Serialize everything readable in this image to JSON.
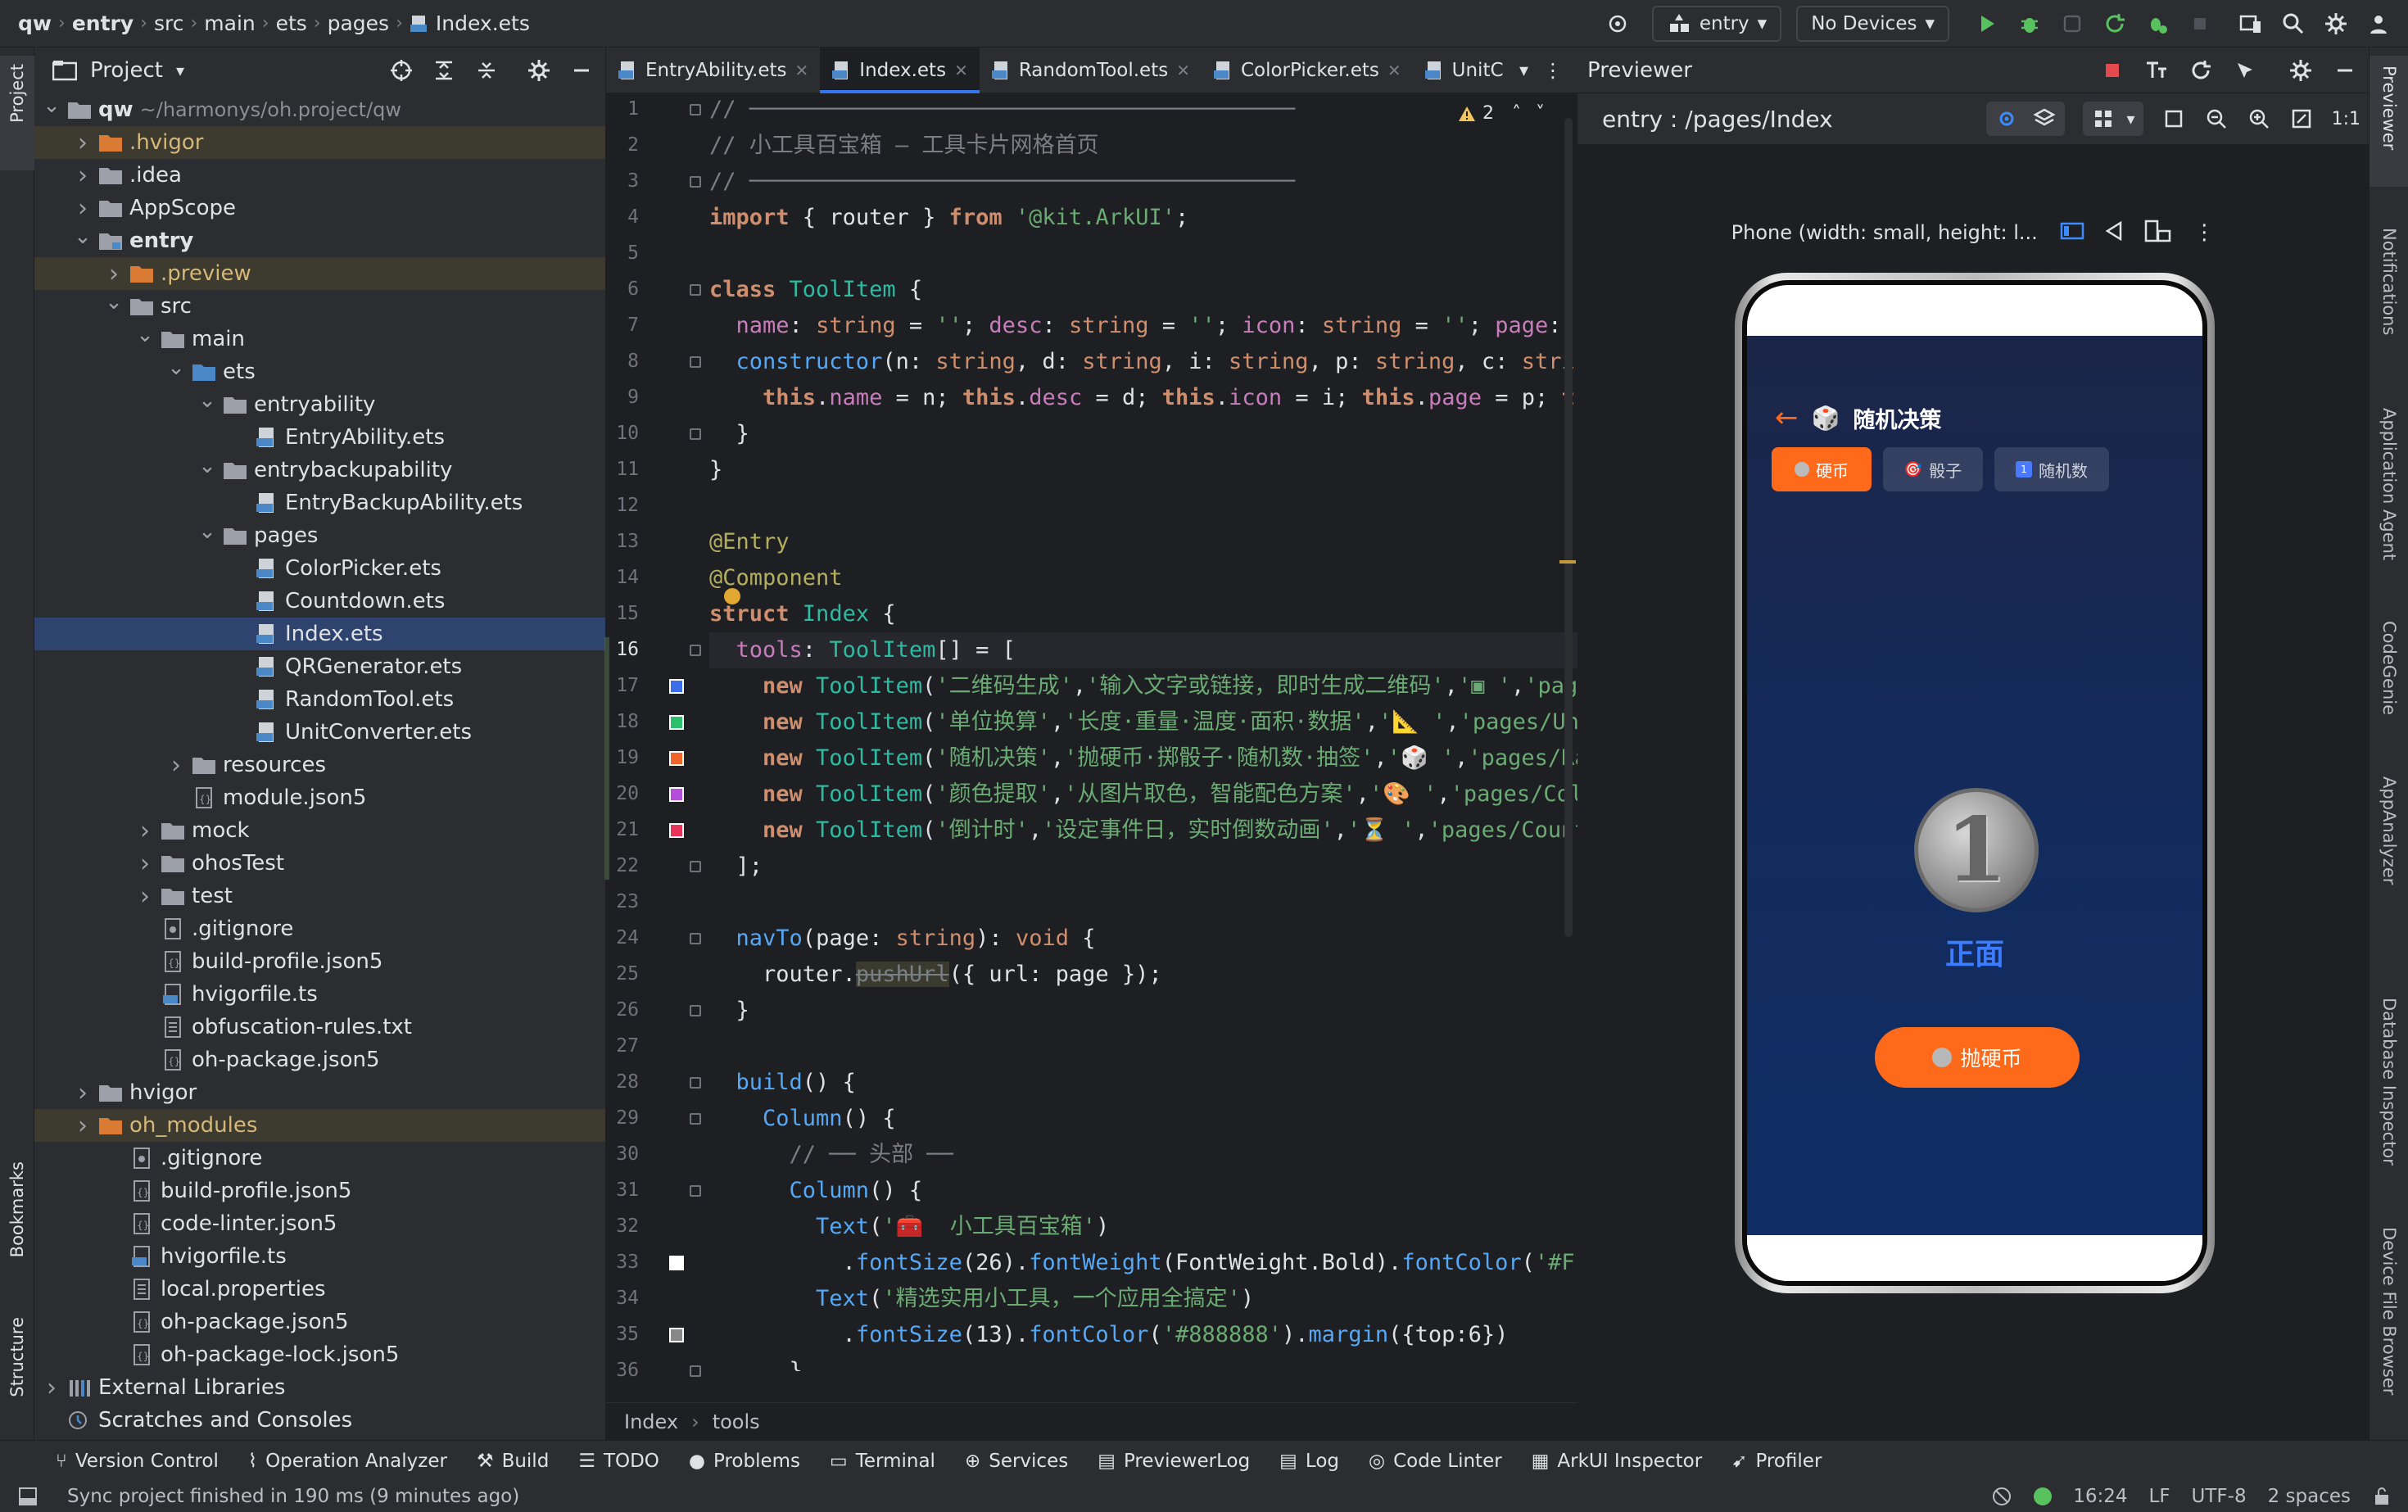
{
  "breadcrumbs": [
    "qw",
    "entry",
    "src",
    "main",
    "ets",
    "pages",
    "Index.ets"
  ],
  "toolbar": {
    "run_config": "entry",
    "device": "No Devices"
  },
  "left_strip": {
    "project": "Project",
    "bookmarks": "Bookmarks",
    "structure": "Structure"
  },
  "right_strip": {
    "previewer": "Previewer",
    "notifications": "Notifications",
    "app_agent": "Application Agent",
    "codegenie": "CodeGenie",
    "appanalyzer": "AppAnalyzer",
    "db_inspector": "Database Inspector",
    "device_file": "Device File Browser"
  },
  "project_panel": {
    "title": "Project",
    "tree": [
      {
        "label": "qw",
        "dim": "~/harmonys/oh.project/qw",
        "depth": 0,
        "chev": "v",
        "type": "folder",
        "bold": true
      },
      {
        "label": ".hvigor",
        "depth": 1,
        "chev": ">",
        "type": "folder-orange",
        "excluded": true
      },
      {
        "label": ".idea",
        "depth": 1,
        "chev": ">",
        "type": "folder"
      },
      {
        "label": "AppScope",
        "depth": 1,
        "chev": ">",
        "type": "folder"
      },
      {
        "label": "entry",
        "depth": 1,
        "chev": "v",
        "type": "folder-module",
        "bold": true
      },
      {
        "label": ".preview",
        "depth": 2,
        "chev": ">",
        "type": "folder-orange",
        "excluded": true
      },
      {
        "label": "src",
        "depth": 2,
        "chev": "v",
        "type": "folder"
      },
      {
        "label": "main",
        "depth": 3,
        "chev": "v",
        "type": "folder"
      },
      {
        "label": "ets",
        "depth": 4,
        "chev": "v",
        "type": "folder-blue"
      },
      {
        "label": "entryability",
        "depth": 5,
        "chev": "v",
        "type": "folder"
      },
      {
        "label": "EntryAbility.ets",
        "depth": 6,
        "chev": "",
        "type": "ets"
      },
      {
        "label": "entrybackupability",
        "depth": 5,
        "chev": "v",
        "type": "folder"
      },
      {
        "label": "EntryBackupAbility.ets",
        "depth": 6,
        "chev": "",
        "type": "ets"
      },
      {
        "label": "pages",
        "depth": 5,
        "chev": "v",
        "type": "folder"
      },
      {
        "label": "ColorPicker.ets",
        "depth": 6,
        "chev": "",
        "type": "ets"
      },
      {
        "label": "Countdown.ets",
        "depth": 6,
        "chev": "",
        "type": "ets"
      },
      {
        "label": "Index.ets",
        "depth": 6,
        "chev": "",
        "type": "ets",
        "selected": true
      },
      {
        "label": "QRGenerator.ets",
        "depth": 6,
        "chev": "",
        "type": "ets"
      },
      {
        "label": "RandomTool.ets",
        "depth": 6,
        "chev": "",
        "type": "ets"
      },
      {
        "label": "UnitConverter.ets",
        "depth": 6,
        "chev": "",
        "type": "ets"
      },
      {
        "label": "resources",
        "depth": 4,
        "chev": ">",
        "type": "folder"
      },
      {
        "label": "module.json5",
        "depth": 4,
        "chev": "",
        "type": "json"
      },
      {
        "label": "mock",
        "depth": 3,
        "chev": ">",
        "type": "folder"
      },
      {
        "label": "ohosTest",
        "depth": 3,
        "chev": ">",
        "type": "folder"
      },
      {
        "label": "test",
        "depth": 3,
        "chev": ">",
        "type": "folder"
      },
      {
        "label": ".gitignore",
        "depth": 3,
        "chev": "",
        "type": "file"
      },
      {
        "label": "build-profile.json5",
        "depth": 3,
        "chev": "",
        "type": "json"
      },
      {
        "label": "hvigorfile.ts",
        "depth": 3,
        "chev": "",
        "type": "ts"
      },
      {
        "label": "obfuscation-rules.txt",
        "depth": 3,
        "chev": "",
        "type": "txt"
      },
      {
        "label": "oh-package.json5",
        "depth": 3,
        "chev": "",
        "type": "json"
      },
      {
        "label": "hvigor",
        "depth": 1,
        "chev": ">",
        "type": "folder"
      },
      {
        "label": "oh_modules",
        "depth": 1,
        "chev": ">",
        "type": "folder-orange",
        "excluded": true
      },
      {
        "label": ".gitignore",
        "depth": 2,
        "chev": "",
        "type": "file"
      },
      {
        "label": "build-profile.json5",
        "depth": 2,
        "chev": "",
        "type": "json"
      },
      {
        "label": "code-linter.json5",
        "depth": 2,
        "chev": "",
        "type": "json"
      },
      {
        "label": "hvigorfile.ts",
        "depth": 2,
        "chev": "",
        "type": "ts"
      },
      {
        "label": "local.properties",
        "depth": 2,
        "chev": "",
        "type": "txt"
      },
      {
        "label": "oh-package.json5",
        "depth": 2,
        "chev": "",
        "type": "json"
      },
      {
        "label": "oh-package-lock.json5",
        "depth": 2,
        "chev": "",
        "type": "json"
      },
      {
        "label": "External Libraries",
        "depth": 0,
        "chev": ">",
        "type": "lib"
      },
      {
        "label": "Scratches and Consoles",
        "depth": 0,
        "chev": "",
        "type": "scratch"
      }
    ]
  },
  "editor": {
    "tabs": [
      {
        "label": "EntryAbility.ets",
        "active": false
      },
      {
        "label": "Index.ets",
        "active": true
      },
      {
        "label": "RandomTool.ets",
        "active": false
      },
      {
        "label": "ColorPicker.ets",
        "active": false
      },
      {
        "label": "UnitC",
        "active": false
      }
    ],
    "warnings": "2",
    "current_line": 16,
    "breadcrumb": [
      "Index",
      "tools"
    ],
    "swatches": [
      {
        "line": 17,
        "color": "#3b6ee8"
      },
      {
        "line": 18,
        "color": "#2dbf6a"
      },
      {
        "line": 19,
        "color": "#f0652a"
      },
      {
        "line": 20,
        "color": "#b44fd9"
      },
      {
        "line": 21,
        "color": "#e8335a"
      },
      {
        "line": 33,
        "color": "#ffffff"
      },
      {
        "line": 35,
        "color": "#888888"
      }
    ],
    "lines": [
      [
        [
          "cm",
          "//"
        ],
        [
          "cm",
          " ─────────────────────────────────────────"
        ]
      ],
      [
        [
          "cm",
          "// 小工具百宝箱 — 工具卡片网格首页"
        ]
      ],
      [
        [
          "cm",
          "// ─────────────────────────────────────────"
        ]
      ],
      [
        [
          "kw",
          "import"
        ],
        [
          "w",
          " { router } "
        ],
        [
          "kw",
          "from"
        ],
        [
          "str",
          " '@kit.ArkUI'"
        ],
        [
          "w",
          ";"
        ]
      ],
      [],
      [
        [
          "kw",
          "class"
        ],
        [
          "ty",
          " ToolItem"
        ],
        [
          "w",
          " {"
        ]
      ],
      [
        [
          "pr",
          "  name"
        ],
        [
          "w",
          ": "
        ],
        [
          "kw2",
          "string"
        ],
        [
          "w",
          " = "
        ],
        [
          "str",
          "''"
        ],
        [
          "w",
          "; "
        ],
        [
          "pr",
          "desc"
        ],
        [
          "w",
          ": "
        ],
        [
          "kw2",
          "string"
        ],
        [
          "w",
          " = "
        ],
        [
          "str",
          "''"
        ],
        [
          "w",
          "; "
        ],
        [
          "pr",
          "icon"
        ],
        [
          "w",
          ": "
        ],
        [
          "kw2",
          "string"
        ],
        [
          "w",
          " = "
        ],
        [
          "str",
          "''"
        ],
        [
          "w",
          "; "
        ],
        [
          "pr",
          "page"
        ],
        [
          "w",
          ":"
        ]
      ],
      [
        [
          "fn",
          "  constructor"
        ],
        [
          "w",
          "("
        ],
        [
          "w",
          "n: "
        ],
        [
          "kw2",
          "string"
        ],
        [
          "w",
          ", d: "
        ],
        [
          "kw2",
          "string"
        ],
        [
          "w",
          ", i: "
        ],
        [
          "kw2",
          "string"
        ],
        [
          "w",
          ", p: "
        ],
        [
          "kw2",
          "string"
        ],
        [
          "w",
          ", c: "
        ],
        [
          "kw2",
          "stri"
        ]
      ],
      [
        [
          "kw",
          "    this"
        ],
        [
          "w",
          "."
        ],
        [
          "pr",
          "name"
        ],
        [
          "w",
          " = n; "
        ],
        [
          "kw",
          "this"
        ],
        [
          "w",
          "."
        ],
        [
          "pr",
          "desc"
        ],
        [
          "w",
          " = d; "
        ],
        [
          "kw",
          "this"
        ],
        [
          "w",
          "."
        ],
        [
          "pr",
          "icon"
        ],
        [
          "w",
          " = i; "
        ],
        [
          "kw",
          "this"
        ],
        [
          "w",
          "."
        ],
        [
          "pr",
          "page"
        ],
        [
          "w",
          " = p; "
        ],
        [
          "kw",
          "t"
        ]
      ],
      [
        [
          "w",
          "  }"
        ]
      ],
      [
        [
          "w",
          "}"
        ]
      ],
      [],
      [
        [
          "an",
          "@Entry"
        ]
      ],
      [
        [
          "an",
          "@Component"
        ]
      ],
      [
        [
          "kw",
          "struct"
        ],
        [
          "ty",
          " Index"
        ],
        [
          "w",
          " {"
        ]
      ],
      [
        [
          "pr",
          "  tools"
        ],
        [
          "w",
          ": "
        ],
        [
          "ty",
          "ToolItem"
        ],
        [
          "w",
          "[] = ["
        ]
      ],
      [
        [
          "kw",
          "    new"
        ],
        [
          "ty",
          " ToolItem"
        ],
        [
          "w",
          "("
        ],
        [
          "str",
          "'二维码生成'"
        ],
        [
          "w",
          ","
        ],
        [
          "str",
          "'输入文字或链接，即时生成二维码'"
        ],
        [
          "w",
          ","
        ],
        [
          "str",
          "'▣ '"
        ],
        [
          "w",
          ","
        ],
        [
          "str",
          "'pag"
        ]
      ],
      [
        [
          "kw",
          "    new"
        ],
        [
          "ty",
          " ToolItem"
        ],
        [
          "w",
          "("
        ],
        [
          "str",
          "'单位换算'"
        ],
        [
          "w",
          ","
        ],
        [
          "str",
          "'长度·重量·温度·面积·数据'"
        ],
        [
          "w",
          ","
        ],
        [
          "str",
          "'📐 '"
        ],
        [
          "w",
          ","
        ],
        [
          "str",
          "'pages/Uni"
        ]
      ],
      [
        [
          "kw",
          "    new"
        ],
        [
          "ty",
          " ToolItem"
        ],
        [
          "w",
          "("
        ],
        [
          "str",
          "'随机决策'"
        ],
        [
          "w",
          ","
        ],
        [
          "str",
          "'抛硬币·掷骰子·随机数·抽签'"
        ],
        [
          "w",
          ","
        ],
        [
          "str",
          "'🎲 '"
        ],
        [
          "w",
          ","
        ],
        [
          "str",
          "'pages/Ra"
        ]
      ],
      [
        [
          "kw",
          "    new"
        ],
        [
          "ty",
          " ToolItem"
        ],
        [
          "w",
          "("
        ],
        [
          "str",
          "'颜色提取'"
        ],
        [
          "w",
          ","
        ],
        [
          "str",
          "'从图片取色，智能配色方案'"
        ],
        [
          "w",
          ","
        ],
        [
          "str",
          "'🎨 '"
        ],
        [
          "w",
          ","
        ],
        [
          "str",
          "'pages/Col"
        ]
      ],
      [
        [
          "kw",
          "    new"
        ],
        [
          "ty",
          " ToolItem"
        ],
        [
          "w",
          "("
        ],
        [
          "str",
          "'倒计时'"
        ],
        [
          "w",
          ","
        ],
        [
          "str",
          "'设定事件日，实时倒数动画'"
        ],
        [
          "w",
          ","
        ],
        [
          "str",
          "'⏳ '"
        ],
        [
          "w",
          ","
        ],
        [
          "str",
          "'pages/Count"
        ]
      ],
      [
        [
          "w",
          "  ];"
        ]
      ],
      [],
      [
        [
          "fn",
          "  navTo"
        ],
        [
          "w",
          "("
        ],
        [
          "w",
          "page: "
        ],
        [
          "kw2",
          "string"
        ],
        [
          "w",
          "): "
        ],
        [
          "kw2",
          "void"
        ],
        [
          "w",
          " {"
        ]
      ],
      [
        [
          "w",
          "    router."
        ],
        [
          "cm",
          "pushUrl"
        ],
        [
          "w",
          "({ url: page });"
        ]
      ],
      [
        [
          "w",
          "  }"
        ]
      ],
      [],
      [
        [
          "fn",
          "  build"
        ],
        [
          "w",
          "() {"
        ]
      ],
      [
        [
          "fn",
          "    Column"
        ],
        [
          "w",
          "() {"
        ]
      ],
      [
        [
          "cm",
          "      // ── 头部 ──"
        ]
      ],
      [
        [
          "fn",
          "      Column"
        ],
        [
          "w",
          "() {"
        ]
      ],
      [
        [
          "fn",
          "        Text"
        ],
        [
          "w",
          "("
        ],
        [
          "str",
          "'🧰  小工具百宝箱'"
        ],
        [
          "w",
          ")"
        ]
      ],
      [
        [
          "w",
          "          ."
        ],
        [
          "fn",
          "fontSize"
        ],
        [
          "w",
          "(26)."
        ],
        [
          "fn",
          "fontWeight"
        ],
        [
          "w",
          "(FontWeight.Bold)."
        ],
        [
          "fn",
          "fontColor"
        ],
        [
          "w",
          "("
        ],
        [
          "str",
          "'#F"
        ]
      ],
      [
        [
          "fn",
          "        Text"
        ],
        [
          "w",
          "("
        ],
        [
          "str",
          "'精选实用小工具，一个应用全搞定'"
        ],
        [
          "w",
          ")"
        ]
      ],
      [
        [
          "w",
          "          ."
        ],
        [
          "fn",
          "fontSize"
        ],
        [
          "w",
          "(13)."
        ],
        [
          "fn",
          "fontColor"
        ],
        [
          "w",
          "("
        ],
        [
          "str",
          "'#888888'"
        ],
        [
          "w",
          ")."
        ],
        [
          "fn",
          "margin"
        ],
        [
          "w",
          "({top:6})"
        ]
      ],
      [
        [
          "w",
          "      }"
        ]
      ]
    ]
  },
  "previewer": {
    "title": "Previewer",
    "route": "entry : /pages/Index",
    "device_label": "Phone (width: small, height: l...",
    "app": {
      "title": "随机决策",
      "tabs": [
        {
          "label": "硬币",
          "active": true
        },
        {
          "label": "骰子",
          "active": false
        },
        {
          "label": "随机数",
          "active": false
        }
      ],
      "coin_value": "1",
      "coin_face": "正面",
      "flip_button": "抛硬币"
    }
  },
  "bottom_tools": [
    "Version Control",
    "Operation Analyzer",
    "Build",
    "TODO",
    "Problems",
    "Terminal",
    "Services",
    "PreviewerLog",
    "Log",
    "Code Linter",
    "ArkUI Inspector",
    "Profiler"
  ],
  "status": {
    "message": "Sync project finished in 190 ms (9 minutes ago)",
    "position": "16:24",
    "line_sep": "LF",
    "encoding": "UTF-8",
    "indent": "2 spaces"
  }
}
